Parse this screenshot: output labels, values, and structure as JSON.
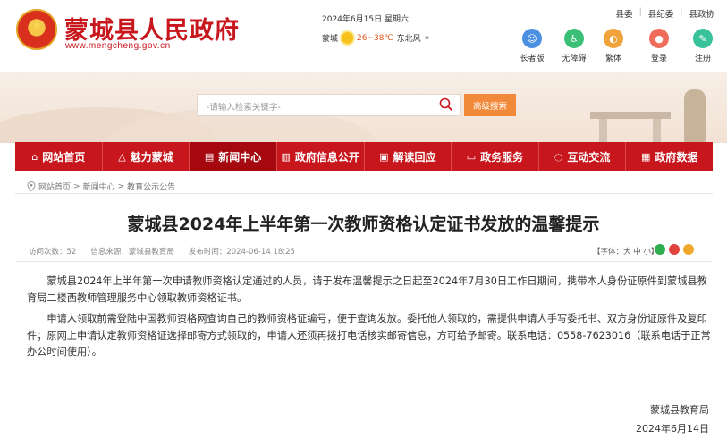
{
  "header": {
    "site_title": "蒙城县人民政府",
    "site_url": "www.mengcheng.gov.cn",
    "date_line": "2024年6月15日 星期六",
    "weather_city": "蒙城",
    "weather_temp": "26~38℃",
    "weather_wind": "东北风",
    "weather_more": "»",
    "top_links": [
      "县委",
      "县纪委",
      "县政协"
    ],
    "quick_links": [
      {
        "label": "长者版",
        "icon": "elder-icon",
        "color": "#4a8fe0"
      },
      {
        "label": "无障碍",
        "icon": "accessibility-icon",
        "color": "#3bbf76"
      },
      {
        "label": "繁体",
        "icon": "traditional-icon",
        "color": "#f0a33a"
      },
      {
        "label": "登录",
        "icon": "login-icon",
        "color": "#f06c5a"
      },
      {
        "label": "注册",
        "icon": "register-icon",
        "color": "#38c29a"
      }
    ]
  },
  "search": {
    "placeholder": "-请输入检索关键字-",
    "button": "高级搜索"
  },
  "nav": {
    "items": [
      {
        "label": "网站首页",
        "icon": "home-icon",
        "glyph": "⌂"
      },
      {
        "label": "魅力蒙城",
        "icon": "mountain-icon",
        "glyph": "△"
      },
      {
        "label": "新闻中心",
        "icon": "news-icon",
        "glyph": "▤"
      },
      {
        "label": "政府信息公开",
        "icon": "document-icon",
        "glyph": "▥"
      },
      {
        "label": "解读回应",
        "icon": "interpret-icon",
        "glyph": "▣"
      },
      {
        "label": "政务服务",
        "icon": "service-icon",
        "glyph": "▭"
      },
      {
        "label": "互动交流",
        "icon": "chat-icon",
        "glyph": "◌"
      },
      {
        "label": "政府数据",
        "icon": "data-icon",
        "glyph": "▦"
      }
    ],
    "active_index": 2
  },
  "breadcrumb": [
    "网站首页",
    "新闻中心",
    "教育公示公告"
  ],
  "breadcrumb_sep": ">",
  "article": {
    "title": "蒙城县2024年上半年第一次教师资格认定证书发放的温馨提示",
    "visits": "访问次数：52",
    "source": "信息来源：蒙城县教育局",
    "time": "发布时间：2024-06-14 18:25",
    "font_size_label": "【字体：大 中 小】",
    "paragraphs": [
      "蒙城县2024年上半年第一次申请教师资格认定通过的人员，请于发布温馨提示之日起至2024年7月30日工作日期间，携带本人身份证原件到蒙城县教育局二楼西教师管理服务中心领取教师资格证书。",
      "申请人领取前需登陆中国教师资格网查询自己的教师资格证编号，便于查询发放。委托他人领取的，需提供申请人手写委托书、双方身份证原件及复印件；原网上申请认定教师资格证选择邮寄方式领取的，申请人还须再拨打电话核实邮寄信息，方可给予邮寄。联系电话：0558-7623016（联系电话于正常办公时间使用）。"
    ],
    "signature_org": "蒙城县教育局",
    "signature_date": "2024年6月14日"
  },
  "colors": {
    "brand_red": "#c8161d",
    "nav_active": "#a5080f",
    "search_button": "#f0893a"
  }
}
